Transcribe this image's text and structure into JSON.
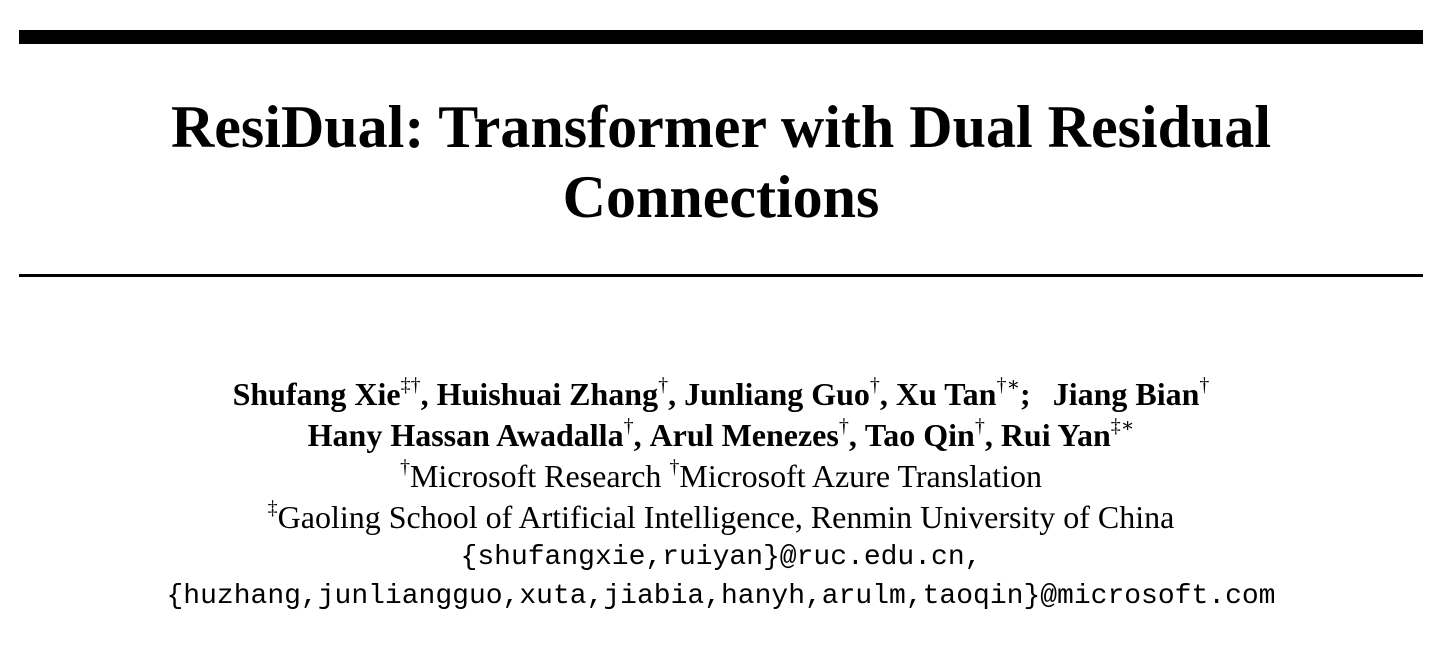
{
  "paper": {
    "title_line1": "ResiDual: Transformer with Dual Residual",
    "title_line2": "Connections",
    "authors": [
      {
        "name": "Shufang Xie",
        "marks": "‡†"
      },
      {
        "name": "Huishuai Zhang",
        "marks": "†"
      },
      {
        "name": "Junliang Guo",
        "marks": "†"
      },
      {
        "name": "Xu Tan",
        "marks": "†∗"
      },
      {
        "name": "Jiang Bian",
        "marks": "†"
      },
      {
        "name": "Hany Hassan Awadalla",
        "marks": "†"
      },
      {
        "name": "Arul Menezes",
        "marks": "†"
      },
      {
        "name": "Tao Qin",
        "marks": "†"
      },
      {
        "name": "Rui Yan",
        "marks": "‡∗"
      }
    ],
    "affiliations": {
      "mark1": "†",
      "aff1": "Microsoft Research",
      "mark2": "†",
      "aff2": "Microsoft Azure Translation",
      "mark3": "‡",
      "aff3": "Gaoling School of Artificial Intelligence, Renmin University of China"
    },
    "emails": {
      "line1": "{shufangxie,ruiyan}@ruc.edu.cn,",
      "line2": "{huzhang,junliangguo,xuta,jiabia,hanyh,arulm,taoqin}@microsoft.com"
    },
    "separators": {
      "comma": ",",
      "semicolon": ";"
    }
  }
}
